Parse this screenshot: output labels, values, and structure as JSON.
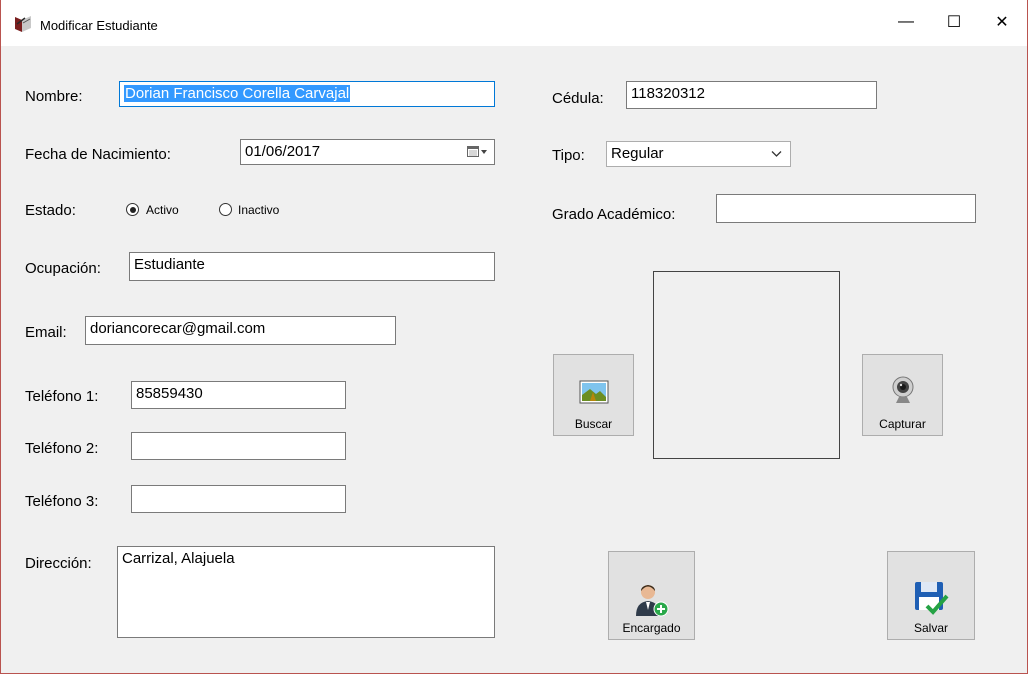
{
  "window": {
    "title": "Modificar Estudiante",
    "controls": {
      "minimize": "—",
      "maximize": "☐",
      "close": "✕"
    }
  },
  "form": {
    "nombre": {
      "label": "Nombre:",
      "value": "Dorian Francisco Corella Carvajal"
    },
    "fecha_nacimiento": {
      "label": "Fecha de Nacimiento:",
      "value": "01/06/2017"
    },
    "estado": {
      "label": "Estado:",
      "options": [
        "Activo",
        "Inactivo"
      ],
      "selected": "Activo"
    },
    "ocupacion": {
      "label": "Ocupación:",
      "value": "Estudiante"
    },
    "email": {
      "label": "Email:",
      "value": "doriancorecar@gmail.com"
    },
    "telefono1": {
      "label": "Teléfono 1:",
      "value": "85859430"
    },
    "telefono2": {
      "label": "Teléfono 2:",
      "value": ""
    },
    "telefono3": {
      "label": "Teléfono 3:",
      "value": ""
    },
    "direccion": {
      "label": "Dirección:",
      "value": "Carrizal, Alajuela"
    },
    "cedula": {
      "label": "Cédula:",
      "value": "118320312"
    },
    "tipo": {
      "label": "Tipo:",
      "value": "Regular"
    },
    "grado_academico": {
      "label": "Grado Académico:",
      "value": ""
    }
  },
  "buttons": {
    "buscar": "Buscar",
    "capturar": "Capturar",
    "encargado": "Encargado",
    "salvar": "Salvar"
  },
  "icons": [
    "app-book-icon",
    "calendar-icon",
    "chevron-down-icon",
    "picture-icon",
    "webcam-icon",
    "add-user-icon",
    "save-disk-icon"
  ],
  "colors": {
    "selection": "#3399ff",
    "focus_border": "#0078d7",
    "window_bg": "#f0f0f0"
  }
}
